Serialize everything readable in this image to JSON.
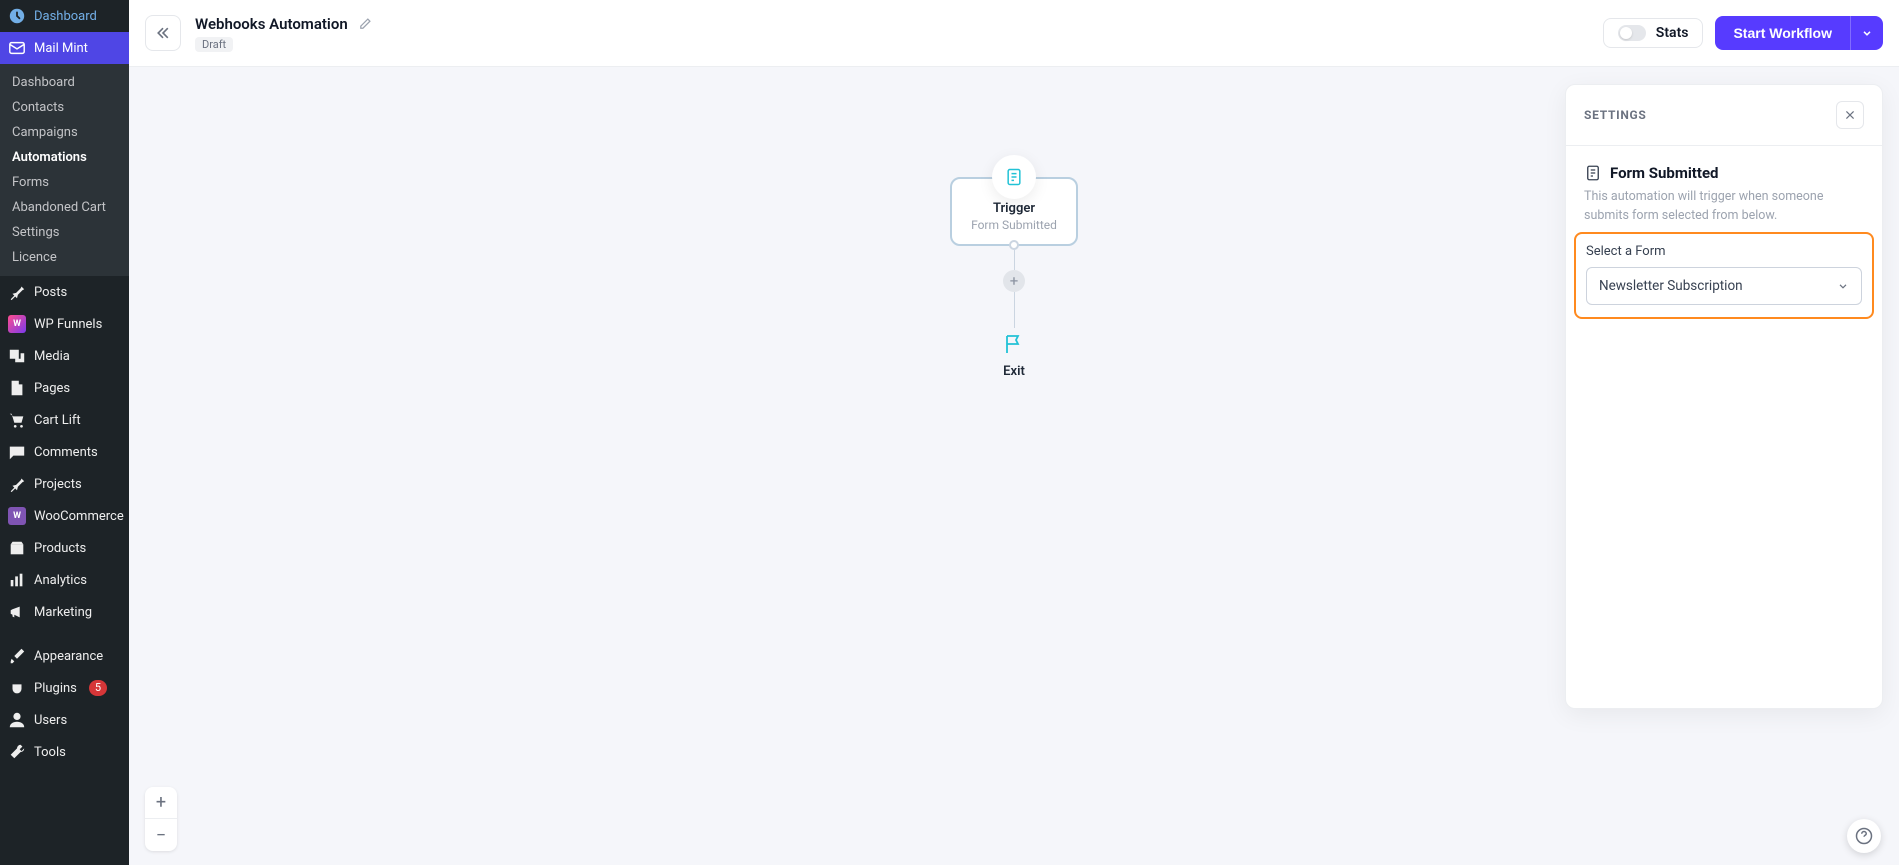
{
  "sidebar": {
    "dashboard": "Dashboard",
    "mail_mint": "Mail Mint",
    "sub_items": {
      "dashboard": "Dashboard",
      "contacts": "Contacts",
      "campaigns": "Campaigns",
      "automations": "Automations",
      "forms": "Forms",
      "abandoned_cart": "Abandoned Cart",
      "settings": "Settings",
      "licence": "Licence"
    },
    "posts": "Posts",
    "wp_funnels": "WP Funnels",
    "media": "Media",
    "pages": "Pages",
    "cart_lift": "Cart Lift",
    "comments": "Comments",
    "projects": "Projects",
    "woocommerce": "WooCommerce",
    "products": "Products",
    "analytics": "Analytics",
    "marketing": "Marketing",
    "appearance": "Appearance",
    "plugins": "Plugins",
    "plugins_count": "5",
    "users": "Users",
    "tools": "Tools"
  },
  "header": {
    "title": "Webhooks Automation",
    "draft": "Draft",
    "stats": "Stats",
    "start_workflow": "Start Workflow"
  },
  "flow": {
    "trigger_title": "Trigger",
    "trigger_sub": "Form Submitted",
    "exit": "Exit"
  },
  "settings": {
    "panel_title": "SETTINGS",
    "section_title": "Form Submitted",
    "section_desc": "This automation will trigger when someone submits form selected from below.",
    "select_label": "Select a Form",
    "select_value": "Newsletter Subscription"
  }
}
